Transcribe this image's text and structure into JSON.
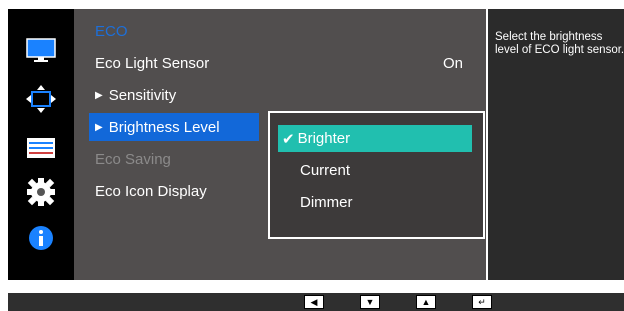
{
  "menu": {
    "title": "ECO",
    "items": [
      {
        "label": "Eco Light Sensor",
        "value": "On"
      },
      {
        "label": "Sensitivity"
      },
      {
        "label": "Brightness Level"
      },
      {
        "label": "Eco Saving"
      },
      {
        "label": "Eco Icon Display"
      }
    ]
  },
  "submenu": {
    "options": [
      "Brighter",
      "Current",
      "Dimmer"
    ],
    "selected": "Brighter"
  },
  "help": {
    "text": "Select the brightness level of ECO light sensor."
  },
  "icons": {
    "sidebar": [
      "monitor-icon",
      "size-position-icon",
      "setup-reset-icon",
      "gear-icon",
      "info-icon"
    ],
    "nav": [
      "left-arrow-icon",
      "down-arrow-icon",
      "up-arrow-icon",
      "enter-icon"
    ]
  },
  "colors": {
    "menu_bg": "#514e4e",
    "selected_item": "#1268d9",
    "active_option": "#21bfaf",
    "title": "#1d6fd9"
  }
}
